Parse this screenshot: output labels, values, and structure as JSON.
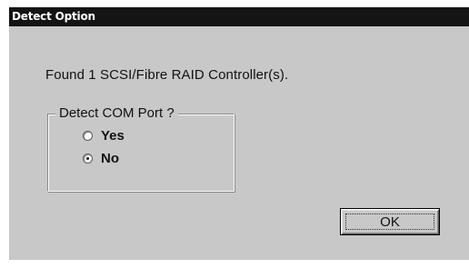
{
  "dialog": {
    "title": "Detect Option",
    "message": "Found 1 SCSI/Fibre RAID Controller(s).",
    "group": {
      "legend": "Detect COM Port ?",
      "options": [
        {
          "label": "Yes",
          "selected": false
        },
        {
          "label": "No",
          "selected": true
        }
      ]
    },
    "ok_label": "OK"
  },
  "colors": {
    "titlebar": "#141414",
    "dialog_background": "#c8c8c8"
  }
}
